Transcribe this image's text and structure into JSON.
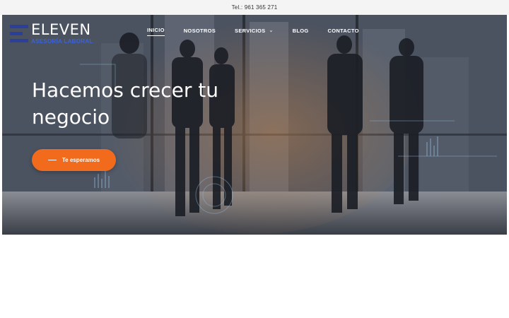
{
  "topbar": {
    "phone": "Tel.: 961 365 271"
  },
  "brand": {
    "name": "ELEVEN",
    "tagline": "ASESORÍA LABORAL",
    "color": "#2b3f9b"
  },
  "nav": {
    "items": [
      {
        "label": "INICIO",
        "active": true
      },
      {
        "label": "NOSOTROS"
      },
      {
        "label": "SERVICIOS",
        "icon": "chevron-down-icon"
      },
      {
        "label": "BLOG"
      },
      {
        "label": "CONTACTO"
      }
    ]
  },
  "hero": {
    "headline_line1": "Hacemos crecer tu",
    "headline_line2": "negocio",
    "cta_label": "Te esperamos",
    "cta_color": "#f26a1b"
  }
}
